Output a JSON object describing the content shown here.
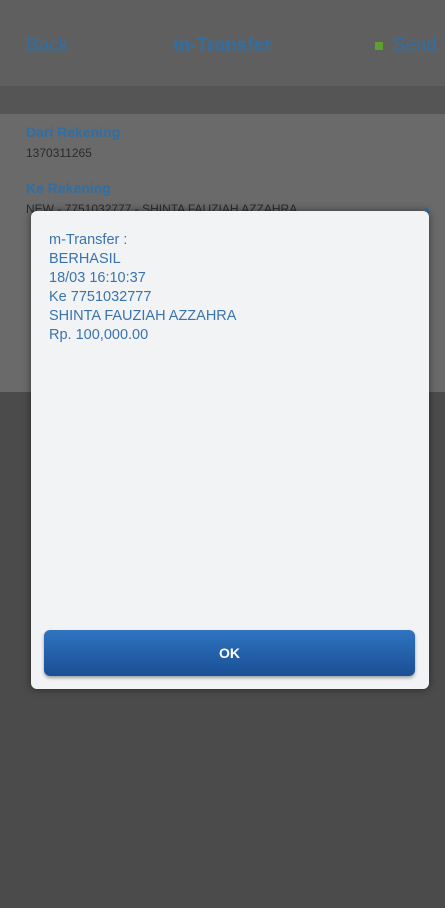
{
  "navbar": {
    "back_label": "Back",
    "title": "m-Transfer",
    "send_label": "Send"
  },
  "form": {
    "from_label": "Dari Rekening",
    "from_value": "1370311265",
    "to_label": "Ke Rekening",
    "to_value": "NEW - 7751032777 - SHINTA FAUZIAH AZZAHRA"
  },
  "dialog": {
    "lines": [
      "m-Transfer :",
      "BERHASIL",
      "18/03 16:10:37",
      "Ke 7751032777",
      "SHINTA FAUZIAH AZZAHRA",
      "Rp. 100,000.00"
    ],
    "ok_label": "OK"
  },
  "colors": {
    "accent": "#2f6fa5",
    "button": "#1f5fa8",
    "send_indicator": "#5da02f"
  }
}
